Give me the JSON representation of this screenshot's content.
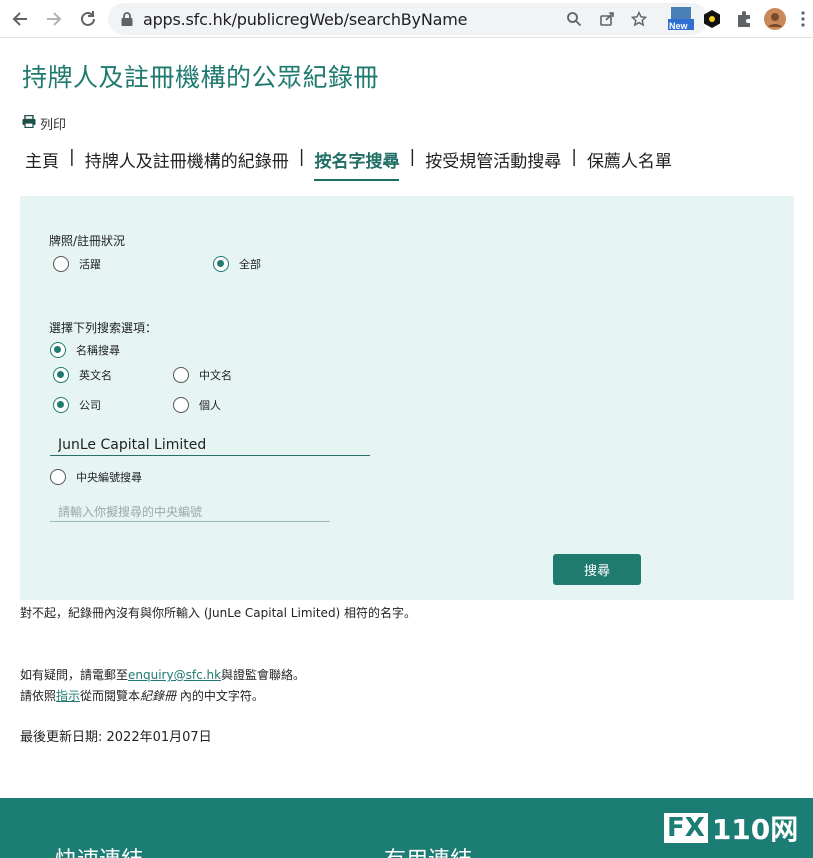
{
  "browser": {
    "url": "apps.sfc.hk/publicregWeb/searchByName",
    "new_badge": "New",
    "icons": [
      "back-arrow-icon",
      "forward-arrow-icon",
      "reload-icon",
      "lock-icon",
      "zoom-icon",
      "share-icon",
      "star-icon",
      "extension-new-icon",
      "extension-badge-icon",
      "puzzle-icon",
      "avatar",
      "menu-dots-icon"
    ]
  },
  "page": {
    "title": "持牌人及註冊機構的公眾紀錄冊",
    "print_label": "列印",
    "tabs": [
      {
        "label": "主頁"
      },
      {
        "label": "持牌人及註冊機構的紀錄冊"
      },
      {
        "label": "按名字搜尋",
        "active": true
      },
      {
        "label": "按受規管活動搜尋"
      },
      {
        "label": "保薦人名單"
      }
    ]
  },
  "form": {
    "status_label": "牌照/註冊狀況",
    "status_options": [
      {
        "label": "活躍",
        "selected": false
      },
      {
        "label": "全部",
        "selected": true
      }
    ],
    "search_options_label": "選擇下列搜索選項：",
    "name_search": {
      "label": "名稱搜尋",
      "selected": true
    },
    "name_lang": [
      {
        "label": "英文名",
        "selected": true
      },
      {
        "label": "中文名",
        "selected": false
      }
    ],
    "entity_type": [
      {
        "label": "公司",
        "selected": true
      },
      {
        "label": "個人",
        "selected": false
      }
    ],
    "name_value": "JunLe Capital Limited",
    "ceref_search": {
      "label": "中央編號搜尋",
      "selected": false
    },
    "ceref_placeholder": "請輸入你擬搜尋的中央編號",
    "search_button": "搜尋"
  },
  "result": {
    "no_match": "對不起，紀錄冊內沒有與你所輸入 (JunLe Capital Limited) 相符的名字。"
  },
  "info": {
    "enquiry_prefix": "如有疑問，請電郵至",
    "enquiry_email": "enquiry@sfc.hk",
    "enquiry_suffix": "與證監會聯絡。",
    "guide_prefix": "請依照",
    "guide_link": "指示",
    "guide_middle": "從而閱覽本",
    "guide_italic": "紀錄冊",
    "guide_suffix": " 內的中文字符。",
    "last_updated": "最後更新日期: 2022年01月07日"
  },
  "footer": {
    "quick_links": "快速連結",
    "useful_links": "有用連結",
    "logo_fx": "FX",
    "logo_num": "110网"
  },
  "colors": {
    "accent": "#1f7a6f",
    "panel_bg": "#e6f5f3",
    "footer_bg": "#1b7d74"
  }
}
